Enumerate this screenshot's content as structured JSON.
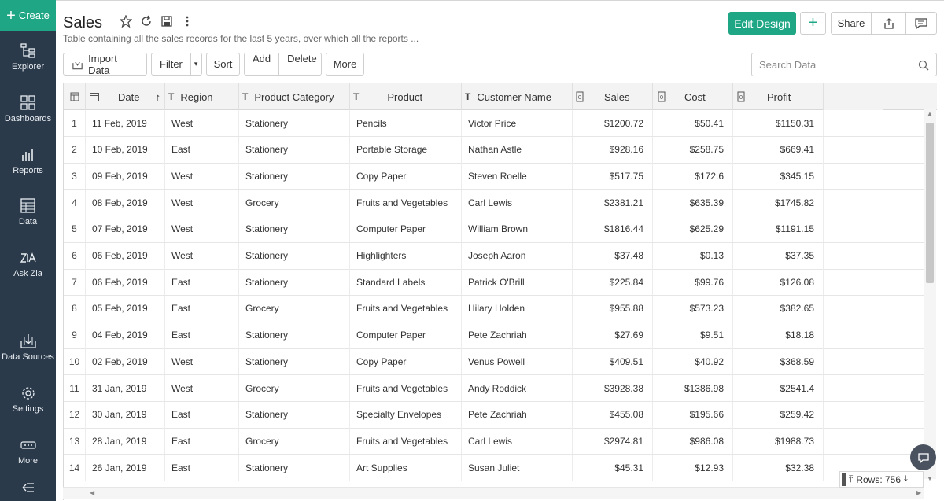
{
  "sidebar": {
    "create_label": "Create",
    "items": [
      {
        "label": "Explorer",
        "icon": "explorer-icon"
      },
      {
        "label": "Dashboards",
        "icon": "dashboards-icon"
      },
      {
        "label": "Reports",
        "icon": "reports-icon"
      },
      {
        "label": "Data",
        "icon": "data-icon"
      },
      {
        "label": "Ask Zia",
        "icon": "ask-zia-icon"
      },
      {
        "label": "Data Sources",
        "icon": "data-sources-icon"
      },
      {
        "label": "Settings",
        "icon": "gear-icon"
      },
      {
        "label": "More",
        "icon": "more-icon"
      }
    ]
  },
  "header": {
    "title": "Sales",
    "subtitle": "Table containing all the sales records for the last 5 years, over which all the reports ...",
    "edit_design": "Edit Design",
    "share": "Share"
  },
  "toolbar": {
    "import": "Import Data",
    "filter": "Filter",
    "sort": "Sort",
    "add": "Add",
    "delete": "Delete",
    "more": "More",
    "search_placeholder": "Search Data"
  },
  "table": {
    "columns": [
      "Date",
      "Region",
      "Product Category",
      "Product",
      "Customer Name",
      "Sales",
      "Cost",
      "Profit"
    ],
    "rows": [
      [
        "1",
        "11 Feb, 2019",
        "West",
        "Stationery",
        "Pencils",
        "Victor Price",
        "$1200.72",
        "$50.41",
        "$1150.31"
      ],
      [
        "2",
        "10 Feb, 2019",
        "East",
        "Stationery",
        "Portable Storage",
        "Nathan Astle",
        "$928.16",
        "$258.75",
        "$669.41"
      ],
      [
        "3",
        "09 Feb, 2019",
        "West",
        "Stationery",
        "Copy Paper",
        "Steven Roelle",
        "$517.75",
        "$172.6",
        "$345.15"
      ],
      [
        "4",
        "08 Feb, 2019",
        "West",
        "Grocery",
        "Fruits and Vegetables",
        "Carl Lewis",
        "$2381.21",
        "$635.39",
        "$1745.82"
      ],
      [
        "5",
        "07 Feb, 2019",
        "West",
        "Stationery",
        "Computer Paper",
        "William Brown",
        "$1816.44",
        "$625.29",
        "$1191.15"
      ],
      [
        "6",
        "06 Feb, 2019",
        "West",
        "Stationery",
        "Highlighters",
        "Joseph Aaron",
        "$37.48",
        "$0.13",
        "$37.35"
      ],
      [
        "7",
        "06 Feb, 2019",
        "East",
        "Stationery",
        "Standard Labels",
        "Patrick O'Brill",
        "$225.84",
        "$99.76",
        "$126.08"
      ],
      [
        "8",
        "05 Feb, 2019",
        "East",
        "Grocery",
        "Fruits and Vegetables",
        "Hilary Holden",
        "$955.88",
        "$573.23",
        "$382.65"
      ],
      [
        "9",
        "04 Feb, 2019",
        "East",
        "Stationery",
        "Computer Paper",
        "Pete Zachriah",
        "$27.69",
        "$9.51",
        "$18.18"
      ],
      [
        "10",
        "02 Feb, 2019",
        "West",
        "Stationery",
        "Copy Paper",
        "Venus Powell",
        "$409.51",
        "$40.92",
        "$368.59"
      ],
      [
        "11",
        "31 Jan, 2019",
        "West",
        "Grocery",
        "Fruits and Vegetables",
        "Andy Roddick",
        "$3928.38",
        "$1386.98",
        "$2541.4"
      ],
      [
        "12",
        "30 Jan, 2019",
        "East",
        "Stationery",
        "Specialty Envelopes",
        "Pete Zachriah",
        "$455.08",
        "$195.66",
        "$259.42"
      ],
      [
        "13",
        "28 Jan, 2019",
        "East",
        "Grocery",
        "Fruits and Vegetables",
        "Carl Lewis",
        "$2974.81",
        "$986.08",
        "$1988.73"
      ],
      [
        "14",
        "26 Jan, 2019",
        "East",
        "Stationery",
        "Art Supplies",
        "Susan Juliet",
        "$45.31",
        "$12.93",
        "$32.38"
      ]
    ]
  },
  "footer": {
    "rows_label": "Rows: 756"
  },
  "colors": {
    "accent": "#1fa785",
    "sidebar": "#2b3a4a"
  }
}
